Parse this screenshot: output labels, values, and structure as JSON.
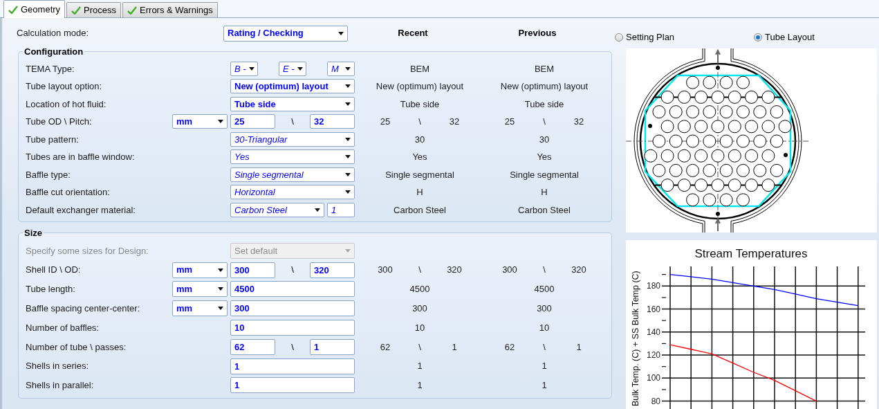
{
  "tabs": [
    {
      "label": "Geometry",
      "selected": true
    },
    {
      "label": "Process",
      "selected": false
    },
    {
      "label": "Errors & Warnings",
      "selected": false
    }
  ],
  "calculation_mode": {
    "label": "Calculation mode:",
    "value": "Rating / Checking",
    "bold": true,
    "italic": false
  },
  "columns": {
    "recent": "Recent",
    "previous": "Previous"
  },
  "groups": [
    {
      "title": "Configuration",
      "rows": [
        {
          "label": "TEMA Type:",
          "disabled": false,
          "controls": [
            {
              "kind": "select",
              "value": "B -",
              "bold": false,
              "italic": true
            },
            {
              "kind": "select",
              "value": "E -",
              "bold": false,
              "italic": true
            },
            {
              "kind": "select",
              "value": "M",
              "bold": false,
              "italic": true
            }
          ],
          "recent": [
            "BEM"
          ],
          "previous": [
            "BEM"
          ]
        },
        {
          "label": "Tube layout option:",
          "disabled": false,
          "controls": [
            {
              "kind": "select",
              "value": "New (optimum) layout",
              "bold": true,
              "italic": false
            }
          ],
          "recent": [
            "New (optimum) layout"
          ],
          "previous": [
            "New (optimum) layout"
          ]
        },
        {
          "label": "Location of hot fluid:",
          "disabled": false,
          "controls": [
            {
              "kind": "select",
              "value": "Tube side",
              "bold": true,
              "italic": false
            }
          ],
          "recent": [
            "Tube side"
          ],
          "previous": [
            "Tube side"
          ]
        },
        {
          "label": "Tube OD \\ Pitch:",
          "disabled": false,
          "unit": {
            "value": "mm",
            "bold": true,
            "italic": false
          },
          "controls": [
            {
              "kind": "field",
              "value": "25",
              "bold": true,
              "italic": false
            },
            {
              "kind": "separator",
              "value": "\\"
            },
            {
              "kind": "field",
              "value": "32",
              "bold": true,
              "italic": false
            }
          ],
          "recent": [
            "25",
            "\\",
            "32"
          ],
          "previous": [
            "25",
            "\\",
            "32"
          ]
        },
        {
          "label": "Tube pattern:",
          "disabled": false,
          "controls": [
            {
              "kind": "select",
              "value": "30-Triangular",
              "bold": false,
              "italic": true
            }
          ],
          "recent": [
            "30"
          ],
          "previous": [
            "30"
          ]
        },
        {
          "label": "Tubes are in baffle window:",
          "disabled": false,
          "controls": [
            {
              "kind": "select",
              "value": "Yes",
              "bold": false,
              "italic": true
            }
          ],
          "recent": [
            "Yes"
          ],
          "previous": [
            "Yes"
          ]
        },
        {
          "label": "Baffle type:",
          "disabled": false,
          "controls": [
            {
              "kind": "select",
              "value": "Single segmental",
              "bold": false,
              "italic": true
            }
          ],
          "recent": [
            "Single segmental"
          ],
          "previous": [
            "Single segmental"
          ]
        },
        {
          "label": "Baffle cut orientation:",
          "disabled": false,
          "controls": [
            {
              "kind": "select",
              "value": "Horizontal",
              "bold": false,
              "italic": true
            }
          ],
          "recent": [
            "H"
          ],
          "previous": [
            "H"
          ]
        },
        {
          "label": "Default exchanger material:",
          "disabled": false,
          "controls": [
            {
              "kind": "select",
              "value": "Carbon Steel",
              "bold": false,
              "italic": true
            },
            {
              "kind": "field",
              "value": "1",
              "bold": false,
              "italic": true
            }
          ],
          "recent": [
            "Carbon Steel"
          ],
          "previous": [
            "Carbon Steel"
          ]
        }
      ]
    },
    {
      "title": "Size",
      "rows": [
        {
          "label": "Specify some sizes for Design:",
          "disabled": true,
          "controls": [
            {
              "kind": "select",
              "value": "Set default",
              "bold": false,
              "italic": false
            }
          ]
        },
        {
          "label": "Shell ID \\ OD:",
          "disabled": false,
          "unit": {
            "value": "mm",
            "bold": true,
            "italic": false
          },
          "controls": [
            {
              "kind": "field",
              "value": "300",
              "bold": true,
              "italic": false
            },
            {
              "kind": "separator",
              "value": "\\"
            },
            {
              "kind": "field",
              "value": "320",
              "bold": true,
              "italic": false
            }
          ],
          "recent": [
            "300",
            "\\",
            "320"
          ],
          "previous": [
            "300",
            "\\",
            "320"
          ]
        },
        {
          "label": "Tube length:",
          "disabled": false,
          "unit": {
            "value": "mm",
            "bold": true,
            "italic": false
          },
          "controls": [
            {
              "kind": "field",
              "value": "4500",
              "bold": true,
              "italic": false
            }
          ],
          "recent": [
            "4500"
          ],
          "previous": [
            "4500"
          ]
        },
        {
          "label": "Baffle spacing center-center:",
          "disabled": false,
          "unit": {
            "value": "mm",
            "bold": true,
            "italic": false
          },
          "controls": [
            {
              "kind": "field",
              "value": "300",
              "bold": true,
              "italic": false
            }
          ],
          "recent": [
            "300"
          ],
          "previous": [
            "300"
          ]
        },
        {
          "label": "Number of baffles:",
          "disabled": false,
          "controls": [
            {
              "kind": "field",
              "value": "10",
              "bold": true,
              "italic": false
            }
          ],
          "recent": [
            "10"
          ],
          "previous": [
            "10"
          ]
        },
        {
          "label": "Number of tube \\ passes:",
          "disabled": false,
          "controls": [
            {
              "kind": "field",
              "value": "62",
              "bold": true,
              "italic": false
            },
            {
              "kind": "separator",
              "value": "\\"
            },
            {
              "kind": "field",
              "value": "1",
              "bold": true,
              "italic": false
            }
          ],
          "recent": [
            "62",
            "\\",
            "1"
          ],
          "previous": [
            "62",
            "\\",
            "1"
          ]
        },
        {
          "label": "Shells in series:",
          "disabled": false,
          "controls": [
            {
              "kind": "field",
              "value": "1",
              "bold": true,
              "italic": false
            }
          ],
          "recent": [
            "1"
          ],
          "previous": [
            "1"
          ]
        },
        {
          "label": "Shells in parallel:",
          "disabled": false,
          "controls": [
            {
              "kind": "field",
              "value": "1",
              "bold": true,
              "italic": false
            }
          ],
          "recent": [
            "1"
          ],
          "previous": [
            "1"
          ]
        }
      ]
    }
  ],
  "view_options": [
    {
      "label": "Setting Plan",
      "selected": false
    },
    {
      "label": "Tube Layout",
      "selected": true
    }
  ],
  "chart": {
    "chart_data": {
      "type": "line",
      "title": "Stream Temperatures",
      "ylabel": "Bulk Temp. (C) + SS Bulk Temp (C)",
      "grid": true,
      "categories": [
        null,
        null,
        null,
        null,
        null,
        null,
        null,
        null,
        null,
        null
      ],
      "ylim": [
        80,
        197
      ],
      "yticks": [
        80,
        100,
        120,
        140,
        160,
        180
      ],
      "series": [
        {
          "color": "#0000ff",
          "values": [
            190,
            188,
            186,
            183,
            180,
            177,
            173,
            169,
            166,
            163
          ]
        },
        {
          "color": "#ff0000",
          "values": [
            129,
            125,
            121,
            113,
            105,
            98,
            89,
            80,
            null,
            null
          ]
        }
      ]
    }
  }
}
